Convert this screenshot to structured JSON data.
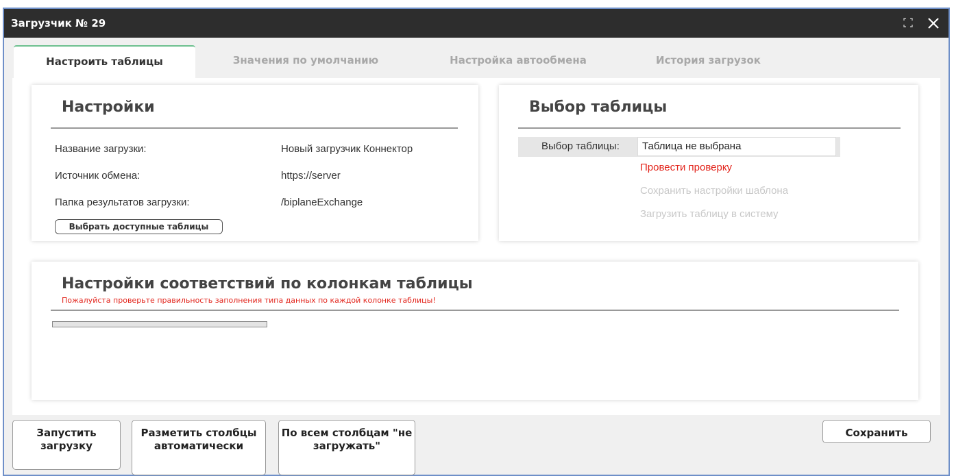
{
  "window": {
    "title": "Загрузчик № 29",
    "colors": {
      "titlebar": "#2d2d2d",
      "border": "#6e8fc8",
      "active_tab_accent": "#6cc08f",
      "warning": "#e2231a",
      "link_active": "#e2231a",
      "link_disabled": "#c8c8c8"
    }
  },
  "tabs": [
    {
      "label": "Настроить таблицы",
      "active": true
    },
    {
      "label": "Значения по умолчанию",
      "active": false
    },
    {
      "label": "Настройка автообмена",
      "active": false
    },
    {
      "label": "История загрузок",
      "active": false
    }
  ],
  "settings": {
    "title": "Настройки",
    "fields": [
      {
        "label": "Название загрузки:",
        "value": "Новый загрузчик Коннектор"
      },
      {
        "label": "Источник обмена:",
        "value": "https://server"
      },
      {
        "label": "Папка результатов загрузки:",
        "value": "/biplaneExchange"
      }
    ],
    "button_label": "Выбрать доступные таблицы"
  },
  "table_select": {
    "title": "Выбор таблицы",
    "field_label": "Выбор таблицы:",
    "field_value": "Таблица не выбрана",
    "actions": [
      {
        "label": "Провести проверку",
        "enabled": true
      },
      {
        "label": "Сохранить настройки шаблона",
        "enabled": false
      },
      {
        "label": "Загрузить таблицу в систему",
        "enabled": false
      }
    ]
  },
  "mapping": {
    "title": "Настройки соответствий по колонкам таблицы",
    "warning": "Пожалуйста проверьте правильность заполнения типа данных по каждой колонке таблицы!"
  },
  "footer": {
    "run_label": "Запустить загрузку",
    "auto_label": "Разметить столбцы автоматически",
    "skip_label": "По всем столбцам \"не загружать\"",
    "save_label": "Сохранить"
  }
}
